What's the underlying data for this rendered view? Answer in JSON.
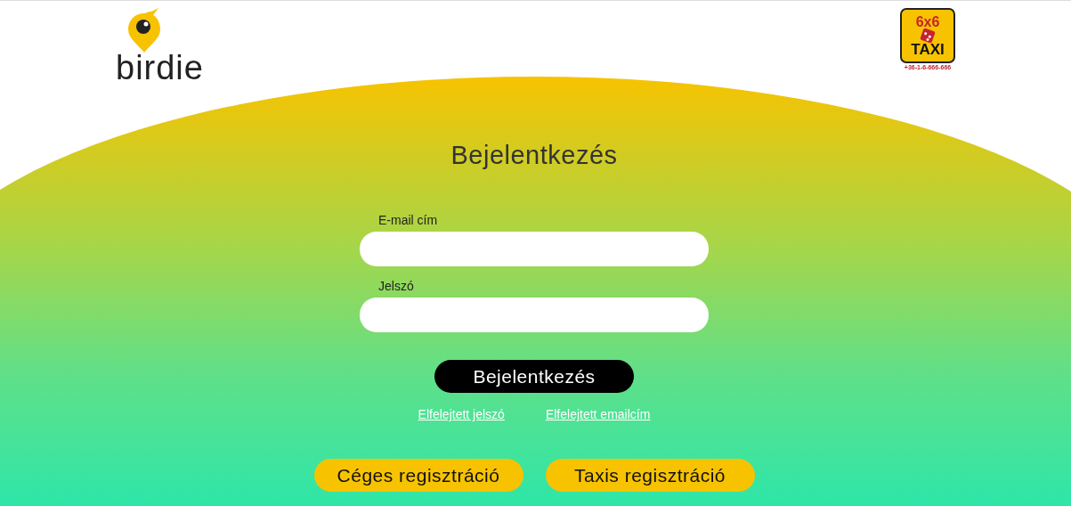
{
  "header": {
    "brand": "birdie",
    "partner_logo": {
      "top": "6x6",
      "bottom": "TAXI",
      "phone": "+36-1-6-666-666"
    }
  },
  "login": {
    "title": "Bejelentkezés",
    "fields": [
      {
        "label": "E-mail cím"
      },
      {
        "label": "Jelszó"
      }
    ],
    "submit": "Bejelentkezés",
    "links": [
      "Elfelejtett jelszó",
      "Elfelejtett emailcím"
    ]
  },
  "registration_buttons": [
    "Céges regisztráció",
    "Taxis regisztráció"
  ]
}
